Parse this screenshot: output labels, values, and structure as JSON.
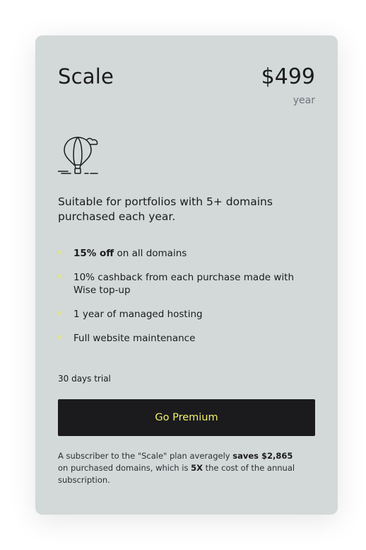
{
  "plan": {
    "name": "Scale",
    "price": "$499",
    "period": "year",
    "icon": "hot-air-balloon-icon",
    "description": "Suitable for portfolios with 5+ domains purchased each year."
  },
  "features": [
    {
      "bold": "15% off",
      "text": " on all domains"
    },
    {
      "bold": "",
      "text": "10% cashback from each purchase made with Wise top-up"
    },
    {
      "bold": "",
      "text": "1 year of managed hosting"
    },
    {
      "bold": "",
      "text": "Full website maintenance"
    }
  ],
  "trial": "30 days trial",
  "cta": {
    "label": "Go Premium"
  },
  "footnote": {
    "part1": "A subscriber to the \"Scale\" plan averagely ",
    "savings": "saves $2,865",
    "part2": " on purchased domains, which is ",
    "multiplier": "5X",
    "part3": " the cost of the annual subscription."
  },
  "colors": {
    "card_background": "#d3d8d8",
    "button_background": "#1b1b1e",
    "accent_yellow": "#f2f06a",
    "muted_text": "#6f7381"
  }
}
